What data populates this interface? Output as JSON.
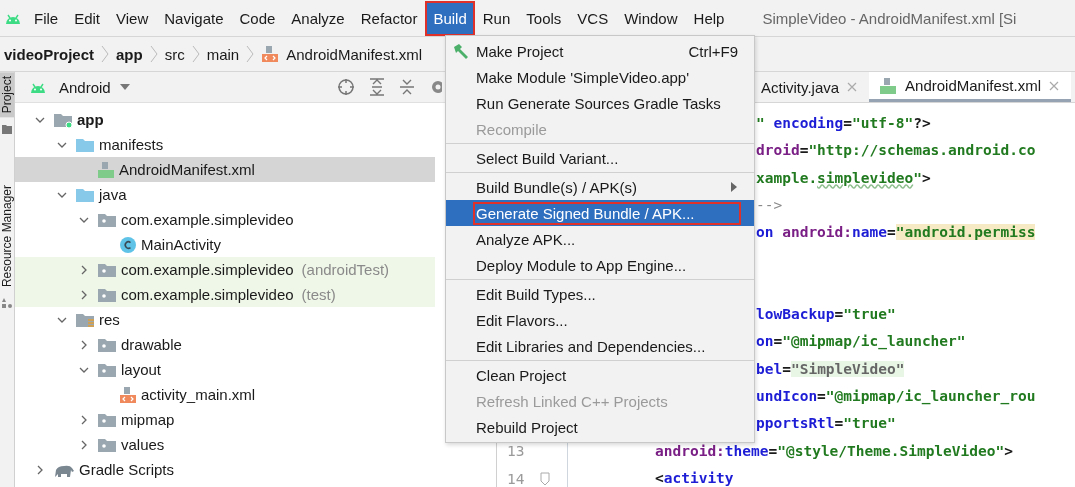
{
  "window": {
    "title": "SimpleVideo - AndroidManifest.xml [Si"
  },
  "menubar": [
    {
      "label": "File",
      "selected": false
    },
    {
      "label": "Edit",
      "selected": false
    },
    {
      "label": "View",
      "selected": false
    },
    {
      "label": "Navigate",
      "selected": false
    },
    {
      "label": "Code",
      "selected": false
    },
    {
      "label": "Analyze",
      "selected": false
    },
    {
      "label": "Refactor",
      "selected": false
    },
    {
      "label": "Build",
      "selected": true,
      "outlined": true
    },
    {
      "label": "Run",
      "selected": false
    },
    {
      "label": "Tools",
      "selected": false
    },
    {
      "label": "VCS",
      "selected": false
    },
    {
      "label": "Window",
      "selected": false
    },
    {
      "label": "Help",
      "selected": false
    }
  ],
  "breadcrumb": [
    {
      "label": "videoProject",
      "kind": "project"
    },
    {
      "label": "app",
      "kind": "module"
    },
    {
      "label": "src",
      "kind": "folder"
    },
    {
      "label": "main",
      "kind": "folder"
    },
    {
      "label": "AndroidManifest.xml",
      "kind": "xml_file"
    }
  ],
  "tool_strip": [
    {
      "label": "Project",
      "selected": true
    },
    {
      "label": "Resource Manager",
      "selected": false
    }
  ],
  "project_panel": {
    "view": "Android",
    "tree": [
      {
        "label": "app",
        "kind": "module",
        "expanded": true,
        "selected": false,
        "children": [
          {
            "label": "manifests",
            "kind": "source_folder",
            "expanded": true,
            "selected": false,
            "children": [
              {
                "label": "AndroidManifest.xml",
                "kind": "manifest_file",
                "selected": true
              }
            ]
          },
          {
            "label": "java",
            "kind": "source_folder",
            "expanded": true,
            "selected": false,
            "children": [
              {
                "label": "com.example.simplevideo",
                "kind": "package",
                "expanded": true,
                "selected": false,
                "children": [
                  {
                    "label": "MainActivity",
                    "kind": "class",
                    "selected": false
                  }
                ]
              },
              {
                "label": "com.example.simplevideo",
                "suffix": "(androidTest)",
                "kind": "package",
                "expanded": false,
                "selected": false,
                "test": true
              },
              {
                "label": "com.example.simplevideo",
                "suffix": "(test)",
                "kind": "package",
                "expanded": false,
                "selected": false,
                "test": true
              }
            ]
          },
          {
            "label": "res",
            "kind": "resource_folder",
            "expanded": true,
            "selected": false,
            "children": [
              {
                "label": "drawable",
                "kind": "package",
                "expanded": false,
                "selected": false
              },
              {
                "label": "layout",
                "kind": "package",
                "expanded": true,
                "selected": false,
                "children": [
                  {
                    "label": "activity_main.xml",
                    "kind": "xml_file",
                    "selected": false
                  }
                ]
              },
              {
                "label": "mipmap",
                "kind": "package",
                "expanded": false,
                "selected": false
              },
              {
                "label": "values",
                "kind": "package",
                "expanded": false,
                "selected": false
              }
            ]
          }
        ]
      },
      {
        "label": "Gradle Scripts",
        "kind": "gradle",
        "expanded": false,
        "selected": false
      }
    ]
  },
  "editor": {
    "tabs": [
      {
        "label": "Activity.java",
        "kind": "java",
        "selected": false
      },
      {
        "label": "AndroidManifest.xml",
        "kind": "manifest",
        "selected": true
      }
    ],
    "lines": [
      {
        "kind": "clipped",
        "segments": [
          {
            "kind": "value",
            "text": "\""
          },
          {
            "kind": "attr",
            "text": " encoding"
          },
          {
            "kind": "punct",
            "text": "="
          },
          {
            "kind": "value",
            "text": "\"utf-8\""
          },
          {
            "kind": "punct",
            "text": "?>"
          }
        ]
      },
      {
        "kind": "clipped",
        "segments": [
          {
            "kind": "ns",
            "text": "droid"
          },
          {
            "kind": "punct",
            "text": "="
          },
          {
            "kind": "value",
            "text": "\"http://schemas.android.co"
          }
        ]
      },
      {
        "kind": "clipped",
        "segments": [
          {
            "kind": "value",
            "text": "xample."
          },
          {
            "kind": "typo",
            "text": "simplevideo"
          },
          {
            "kind": "value",
            "text": "\""
          },
          {
            "kind": "punct",
            "text": ">"
          }
        ]
      },
      {
        "kind": "clipped",
        "segments": [
          {
            "kind": "comment",
            "text": "-->"
          }
        ]
      },
      {
        "kind": "clipped",
        "segments": [
          {
            "kind": "attr",
            "text": "on "
          },
          {
            "kind": "ns",
            "text": "android:"
          },
          {
            "kind": "attr",
            "text": "name"
          },
          {
            "kind": "punct",
            "text": "="
          },
          {
            "kind": "value_hl",
            "text": "\"android.permiss"
          }
        ]
      },
      {
        "kind": "blank"
      },
      {
        "kind": "blank"
      },
      {
        "kind": "clipped",
        "segments": [
          {
            "kind": "attr",
            "text": "lowBackup"
          },
          {
            "kind": "punct",
            "text": "="
          },
          {
            "kind": "value",
            "text": "\"true\""
          }
        ]
      },
      {
        "kind": "clipped",
        "segments": [
          {
            "kind": "attr",
            "text": "on"
          },
          {
            "kind": "punct",
            "text": "="
          },
          {
            "kind": "value",
            "text": "\"@mipmap/ic_launcher\""
          }
        ]
      },
      {
        "kind": "clipped",
        "segments": [
          {
            "kind": "attr",
            "text": "bel"
          },
          {
            "kind": "punct",
            "text": "="
          },
          {
            "kind": "value_ref",
            "text": "\"SimpleVideo\""
          }
        ]
      },
      {
        "kind": "clipped",
        "segments": [
          {
            "kind": "attr",
            "text": "undIcon"
          },
          {
            "kind": "punct",
            "text": "="
          },
          {
            "kind": "value",
            "text": "\"@mipmap/ic_launcher_rou"
          }
        ]
      },
      {
        "kind": "clipped",
        "segments": [
          {
            "kind": "attr",
            "text": "pportsRtl"
          },
          {
            "kind": "punct",
            "text": "="
          },
          {
            "kind": "value",
            "text": "\"true\""
          }
        ]
      },
      {
        "kind": "full",
        "number": "13",
        "segments": [
          {
            "kind": "ns",
            "text": "android:"
          },
          {
            "kind": "attr",
            "text": "theme"
          },
          {
            "kind": "punct",
            "text": "="
          },
          {
            "kind": "value",
            "text": "\"@style/Theme.SimpleVideo\""
          },
          {
            "kind": "punct",
            "text": ">"
          }
        ]
      },
      {
        "kind": "full",
        "number": "14",
        "fold": true,
        "segments": [
          {
            "kind": "punct",
            "text": "<"
          },
          {
            "kind": "attr",
            "text": "activity"
          }
        ]
      }
    ]
  },
  "build_menu": {
    "groups": [
      [
        {
          "label": "Make Project",
          "shortcut": "Ctrl+F9",
          "kind": "hammer",
          "disabled": false,
          "selected": false
        },
        {
          "label": "Make Module 'SimpleVideo.app'",
          "disabled": false,
          "selected": false
        },
        {
          "label": "Run Generate Sources Gradle Tasks",
          "disabled": false,
          "selected": false
        },
        {
          "label": "Recompile",
          "disabled": true,
          "selected": false
        }
      ],
      [
        {
          "label": "Select Build Variant...",
          "disabled": false,
          "selected": false
        }
      ],
      [
        {
          "label": "Build Bundle(s) / APK(s)",
          "submenu": true,
          "disabled": false,
          "selected": false
        },
        {
          "label": "Generate Signed Bundle / APK...",
          "disabled": false,
          "selected": true,
          "outlined": true
        },
        {
          "label": "Analyze APK...",
          "disabled": false,
          "selected": false
        },
        {
          "label": "Deploy Module to App Engine...",
          "disabled": false,
          "selected": false
        }
      ],
      [
        {
          "label": "Edit Build Types...",
          "disabled": false,
          "selected": false
        },
        {
          "label": "Edit Flavors...",
          "disabled": false,
          "selected": false
        },
        {
          "label": "Edit Libraries and Dependencies...",
          "disabled": false,
          "selected": false
        }
      ],
      [
        {
          "label": "Clean Project",
          "disabled": false,
          "selected": false
        },
        {
          "label": "Refresh Linked C++ Projects",
          "disabled": true,
          "selected": false
        },
        {
          "label": "Rebuild Project",
          "disabled": false,
          "selected": false
        }
      ]
    ]
  }
}
